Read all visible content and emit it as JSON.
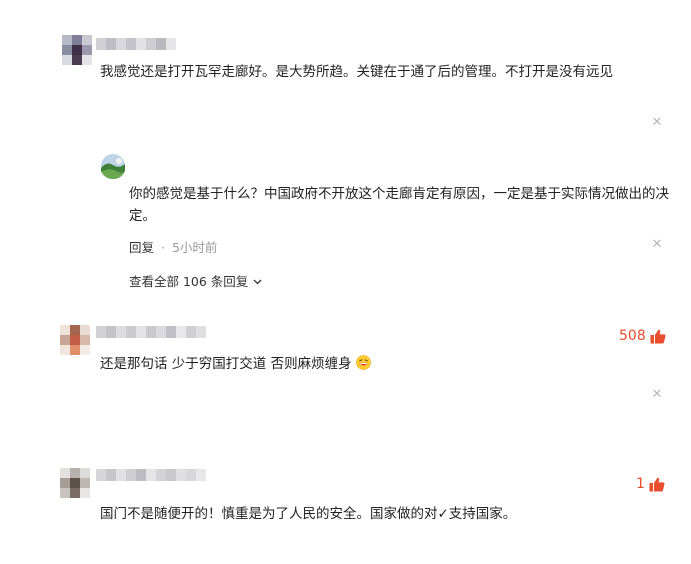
{
  "comments": [
    {
      "text": "我感觉还是打开瓦罕走廊好。是大势所趋。关键在于通了后的管理。不打开是没有远见",
      "reply": {
        "text": "你的感觉是基于什么？中国政府不开放这个走廊肯定有原因，一定是基于实际情况做出的决定。",
        "reply_label": "回复",
        "separator": "·",
        "time": "5小时前"
      },
      "view_all": "查看全部 106 条回复"
    },
    {
      "likes": "508",
      "text": "还是那句话 少于穷国打交道 否则麻烦缠身"
    },
    {
      "likes": "1",
      "text": "国门不是随便开的！慎重是为了人民的安全。国家做的对✓支持国家。"
    }
  ],
  "colors": {
    "accent": "#e84d2e",
    "muted": "#999999",
    "icon": "#b9b9b9"
  },
  "icons": {
    "close": "close-icon",
    "like": "thumbs-up-icon",
    "expand": "chevron-down-icon",
    "emoji": "laughing-emoji-icon"
  }
}
